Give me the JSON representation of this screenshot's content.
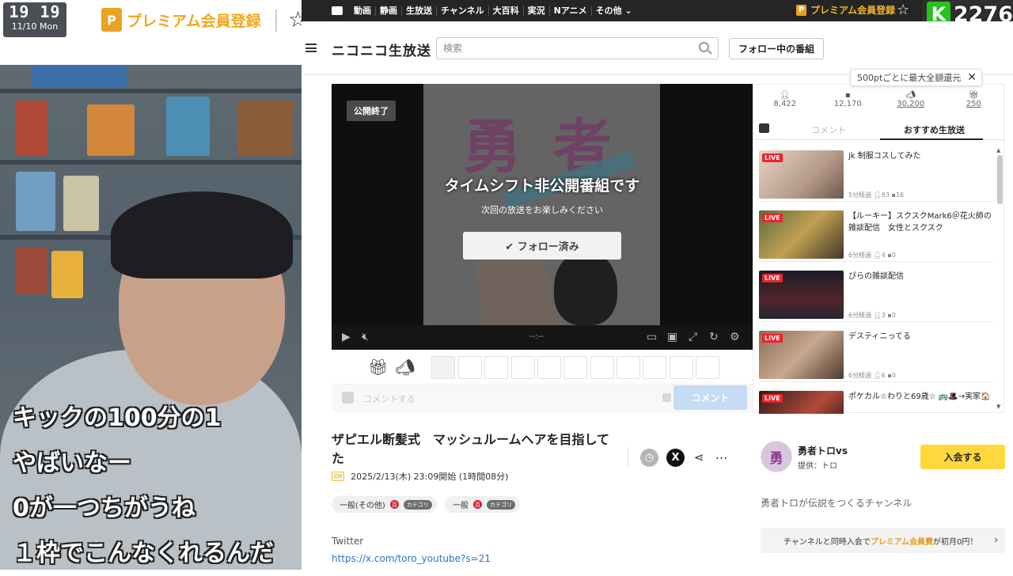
{
  "overlay": {
    "time": "19 19",
    "date": "11/10 Mon",
    "premium_badge": "P",
    "premium_label": "プレミアム会員登録",
    "subtitles": [
      "キックの100分の1",
      "やばいなー",
      "0が一つちがうね",
      "１枠でこんなくれるんだ"
    ]
  },
  "navbar": {
    "links": [
      "動画",
      "静画",
      "生放送",
      "チャンネル",
      "大百科",
      "実況",
      "Nアニメ",
      "その他 ⌄"
    ],
    "premium_label": "プレミアム会員登録",
    "k_logo": "K",
    "count": "2276"
  },
  "header": {
    "logo": "ニコニコ生放送",
    "search_placeholder": "検索",
    "follow_button": "フォロー中の番組"
  },
  "player": {
    "status_badge": "公開終了",
    "message": "タイムシフト非公開番組です",
    "submessage": "次回の放送をお楽しみください",
    "follow_button": "✔ フォロー済み",
    "time": "--:--"
  },
  "comment_bar": {
    "placeholder": "コメントする",
    "submit": "コメント"
  },
  "tooltip": {
    "text": "500ptごとに最大全額還元",
    "close": "✕"
  },
  "stats": [
    {
      "icon": "viewers-icon",
      "value": "8,422"
    },
    {
      "icon": "comments-icon",
      "value": "12,170"
    },
    {
      "icon": "ad-icon",
      "value": "30,200"
    },
    {
      "icon": "gift-icon",
      "value": "250"
    }
  ],
  "panel_tabs": {
    "comment": "コメント",
    "recommended": "おすすめ生放送"
  },
  "recommended": [
    {
      "live": "LIVE",
      "title": "jk 制服コスしてみた",
      "elapsed": "5分経過",
      "viewers": "93",
      "comments": "16"
    },
    {
      "live": "LIVE",
      "title": "【ルーキー】スクスクMark6＠花火師の雑談配信　女性とスクスク",
      "elapsed": "6分経過",
      "viewers": "4",
      "comments": "0"
    },
    {
      "live": "LIVE",
      "title": "ぴらの雑談配信",
      "elapsed": "6分経過",
      "viewers": "3",
      "comments": "0"
    },
    {
      "live": "LIVE",
      "title": "デスティニってる",
      "elapsed": "6分経過",
      "viewers": "6",
      "comments": "0"
    },
    {
      "live": "LIVE",
      "title": "ポケカル☆わりと69歳☆ 🚌🎩→実家🏠",
      "elapsed": "",
      "viewers": "",
      "comments": ""
    }
  ],
  "program": {
    "title": "ザピエル断髪式　マッシュルームヘアを目指してた",
    "ch_badge": "CH",
    "date": "2025/2/13(木) 23:09開始 (1時間08分)",
    "tags": [
      {
        "label": "一般(その他)",
        "badge": "百",
        "category": "カテゴリ"
      },
      {
        "label": "一般",
        "badge": "百",
        "category": "カテゴリ"
      }
    ],
    "twitter_label": "Twitter",
    "twitter_url": "https://x.com/toro_youtube?s=21",
    "actions": {
      "x": "X",
      "share": "⋖",
      "more": "⋯"
    }
  },
  "channel": {
    "avatar_text": "勇",
    "name": "勇者トロvs",
    "provider": "提供：トロ",
    "join_button": "入会する",
    "description": "勇者トロが伝説をつくるチャンネル",
    "premium_pre": "チャンネルと同時入会で",
    "premium_hl": "プレミアム会員費",
    "premium_post": "が初月0円！",
    "arrow": "›"
  }
}
